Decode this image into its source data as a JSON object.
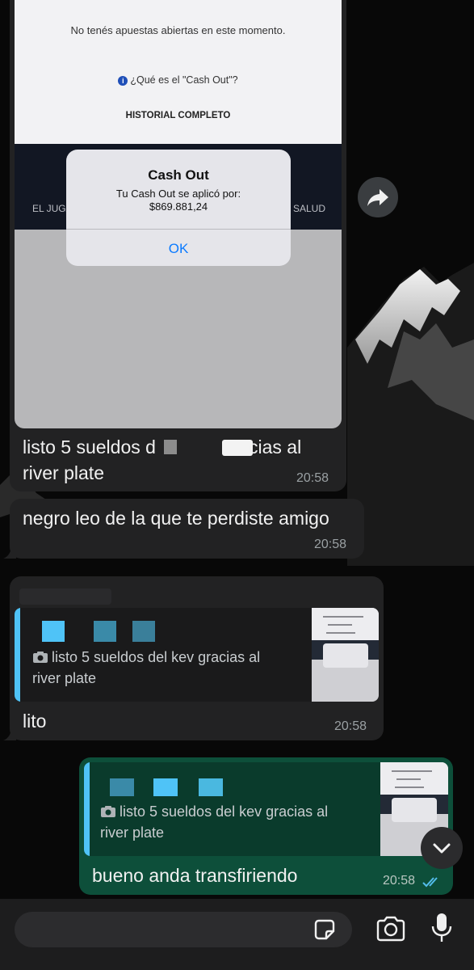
{
  "messages": [
    {
      "type": "image",
      "screenshot": {
        "no_bets_text": "No tenés apuestas abiertas en este momento.",
        "info_icon": "i",
        "cashout_question": "¿Qué es el \"Cash Out\"?",
        "history_button": "HISTORIAL COMPLETO",
        "nav_left": "EL JUGA",
        "nav_right": "SALUD",
        "alert": {
          "title": "Cash Out",
          "line1": "Tu Cash Out se aplicó por:",
          "amount": "$869.881,24",
          "ok": "OK"
        }
      },
      "caption_line1_a": "listo 5 sueldos d",
      "caption_line1_b": "cias al",
      "caption_line2": "river plate",
      "time": "20:58"
    },
    {
      "type": "text",
      "text": "negro leo de la que te perdiste amigo",
      "time": "20:58"
    },
    {
      "type": "reply",
      "quoted_text_line1": "listo 5 sueldos del kev gracias al",
      "quoted_text_line2": "river plate",
      "text": "lito",
      "time": "20:58"
    },
    {
      "type": "reply-outgoing",
      "quoted_text_line1": "listo 5 sueldos del kev gracias al",
      "quoted_text_line2": "river plate",
      "text": "bueno anda transfiriendo",
      "time": "20:58",
      "status": "read"
    }
  ],
  "icons": {
    "forward": "forward-arrow-icon",
    "camera_small": "camera-icon",
    "scroll_down": "chevron-down-icon",
    "sticker": "sticker-icon",
    "camera": "camera-icon",
    "mic": "microphone-icon",
    "read_ticks": "double-check-icon"
  },
  "colors": {
    "incoming_bubble": "#222223",
    "outgoing_bubble": "#0d4f3a",
    "quote_bar_blue": "#4fc3f7",
    "read_ticks": "#53bdeb",
    "ios_ok_blue": "#0a7aff"
  }
}
